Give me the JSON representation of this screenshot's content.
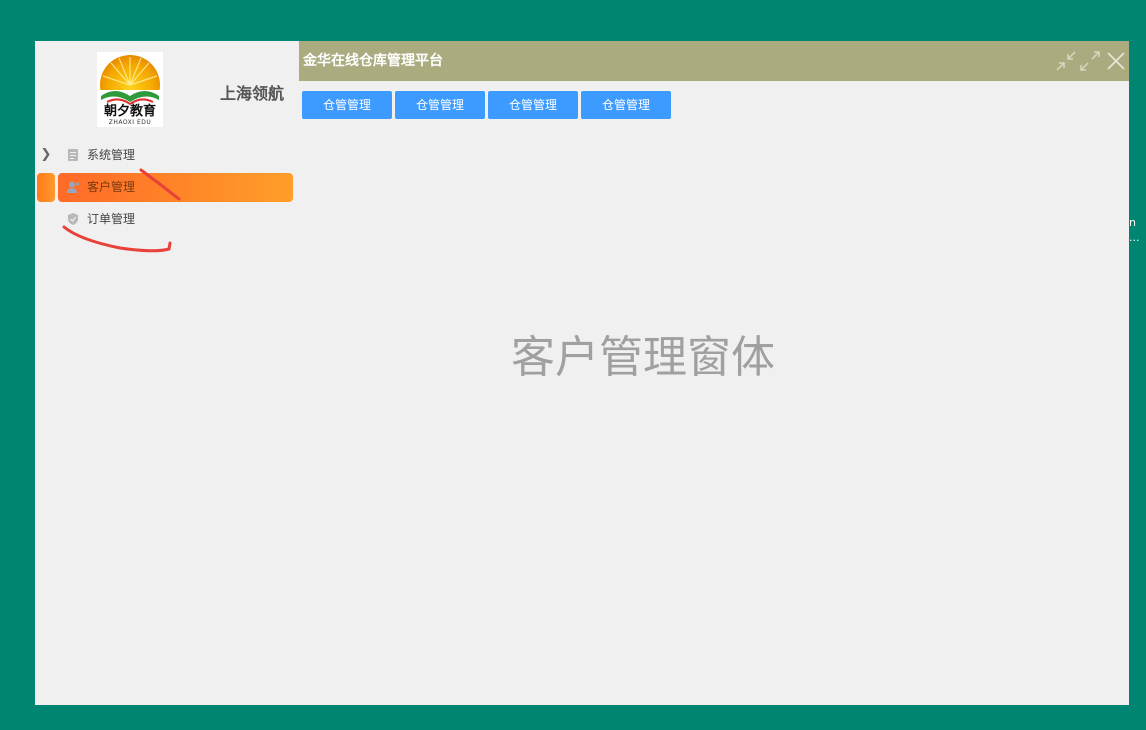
{
  "app": {
    "company_name": "上海领航",
    "title": "金华在线仓库管理平台"
  },
  "logo": {
    "caption": "朝夕教育",
    "subcaption": "ZHAOXI EDU"
  },
  "sidebar": {
    "items": [
      {
        "label": "系统管理",
        "icon": "document-icon",
        "active": false,
        "expandable": true
      },
      {
        "label": "客户管理",
        "icon": "user-icon",
        "active": true,
        "expandable": false
      },
      {
        "label": "订单管理",
        "icon": "shield-icon",
        "active": false,
        "expandable": false
      }
    ]
  },
  "tabs": [
    {
      "label": "仓管管理"
    },
    {
      "label": "仓管管理"
    },
    {
      "label": "仓管管理"
    },
    {
      "label": "仓管管理"
    }
  ],
  "main": {
    "placeholder_text": "客户管理窗体"
  },
  "window_controls": [
    "shrink-icon",
    "expand-icon",
    "close-icon"
  ],
  "edge_text": {
    "line1": "n",
    "line2": "..."
  },
  "colors": {
    "background": "#008573",
    "title_bar": "#abab80",
    "tab_button": "#3d9bff",
    "active_menu_start": "#ff6a28",
    "active_menu_end": "#ff9e28",
    "annotation": "#e8403a"
  }
}
